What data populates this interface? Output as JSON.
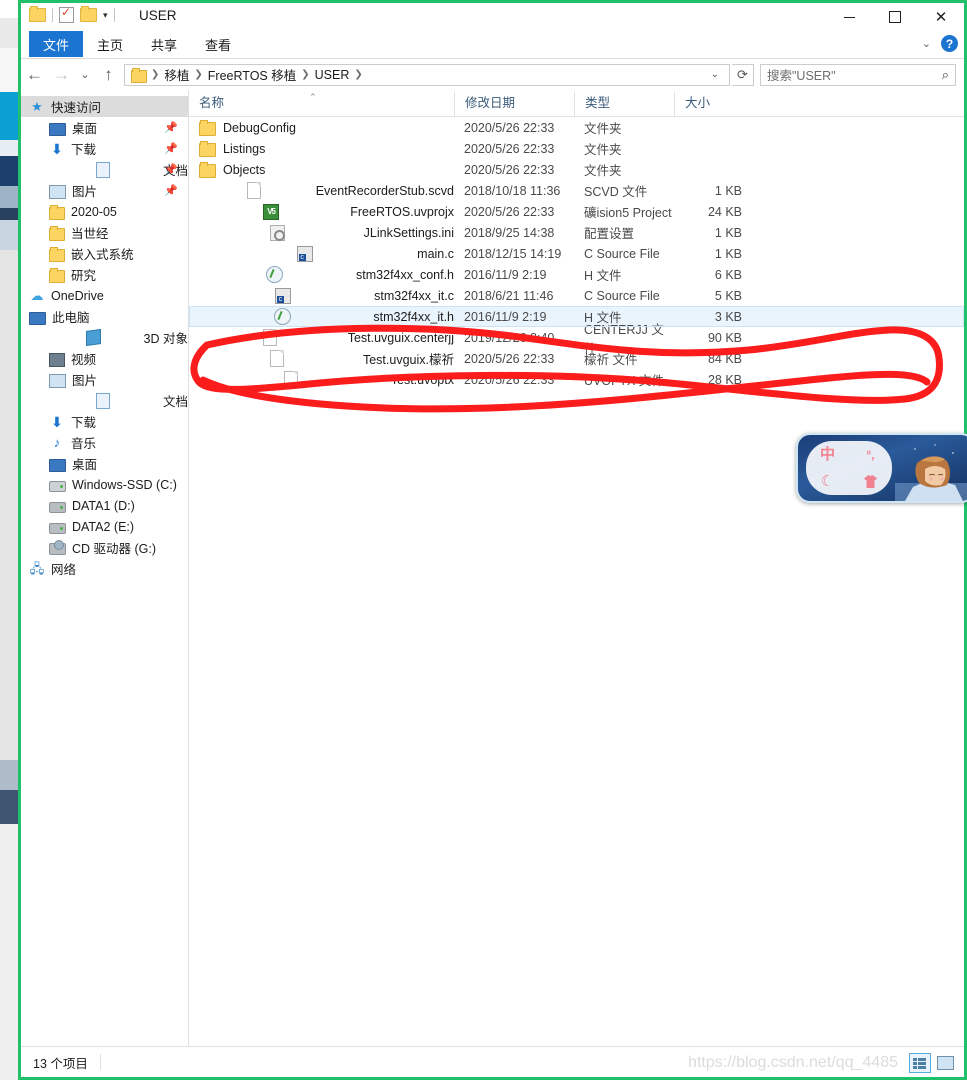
{
  "window": {
    "title": "USER",
    "quick_access": [
      "folder-icon",
      "properties-icon",
      "new-folder-icon",
      "customize-caret"
    ],
    "controls": {
      "minimize": "minimize-icon",
      "maximize": "maximize-icon",
      "close": "close-icon"
    },
    "help_label": "?"
  },
  "ribbon": {
    "tabs": [
      {
        "label": "文件",
        "active": true
      },
      {
        "label": "主页",
        "active": false
      },
      {
        "label": "共享",
        "active": false
      },
      {
        "label": "查看",
        "active": false
      }
    ]
  },
  "address": {
    "back": "back-arrow",
    "forward": "forward-arrow",
    "recent": "recent-caret",
    "up": "up-arrow",
    "breadcrumbs": [
      "移植",
      "FreeRTOS 移植",
      "USER"
    ],
    "dropdown_caret": "⌄",
    "refresh": "refresh-icon"
  },
  "search": {
    "placeholder": "搜索\"USER\"",
    "icon": "search-icon"
  },
  "navpane": {
    "items": [
      {
        "label": "快速访问",
        "icon": "star-icon",
        "indent": 0,
        "selected": true,
        "pinned": false
      },
      {
        "label": "桌面",
        "icon": "monitor-icon",
        "indent": 1,
        "selected": false,
        "pinned": true
      },
      {
        "label": "下载",
        "icon": "download-icon",
        "indent": 1,
        "selected": false,
        "pinned": true
      },
      {
        "label": "文档",
        "icon": "document-icon",
        "indent": 1,
        "selected": false,
        "pinned": true
      },
      {
        "label": "图片",
        "icon": "picture-icon",
        "indent": 1,
        "selected": false,
        "pinned": true
      },
      {
        "label": "2020-05",
        "icon": "folder-icon",
        "indent": 1,
        "selected": false,
        "pinned": false
      },
      {
        "label": "当世经",
        "icon": "folder-icon",
        "indent": 1,
        "selected": false,
        "pinned": false
      },
      {
        "label": "嵌入式系统",
        "icon": "folder-icon",
        "indent": 1,
        "selected": false,
        "pinned": false
      },
      {
        "label": "研究",
        "icon": "folder-icon",
        "indent": 1,
        "selected": false,
        "pinned": false
      },
      {
        "label": "OneDrive",
        "icon": "cloud-icon",
        "indent": 0,
        "selected": false,
        "pinned": false
      },
      {
        "label": "此电脑",
        "icon": "monitor-icon",
        "indent": 0,
        "selected": false,
        "pinned": false
      },
      {
        "label": "3D 对象",
        "icon": "cube-icon",
        "indent": 1,
        "selected": false,
        "pinned": false
      },
      {
        "label": "视频",
        "icon": "video-icon",
        "indent": 1,
        "selected": false,
        "pinned": false
      },
      {
        "label": "图片",
        "icon": "picture-icon",
        "indent": 1,
        "selected": false,
        "pinned": false
      },
      {
        "label": "文档",
        "icon": "document-icon",
        "indent": 1,
        "selected": false,
        "pinned": false
      },
      {
        "label": "下载",
        "icon": "download-icon",
        "indent": 1,
        "selected": false,
        "pinned": false
      },
      {
        "label": "音乐",
        "icon": "music-icon",
        "indent": 1,
        "selected": false,
        "pinned": false
      },
      {
        "label": "桌面",
        "icon": "monitor-icon",
        "indent": 1,
        "selected": false,
        "pinned": false
      },
      {
        "label": "Windows-SSD (C:)",
        "icon": "drive-system-icon",
        "indent": 1,
        "selected": false,
        "pinned": false
      },
      {
        "label": "DATA1 (D:)",
        "icon": "drive-icon",
        "indent": 1,
        "selected": false,
        "pinned": false
      },
      {
        "label": "DATA2 (E:)",
        "icon": "drive-icon",
        "indent": 1,
        "selected": false,
        "pinned": false
      },
      {
        "label": "CD 驱动器 (G:)",
        "icon": "cd-drive-icon",
        "indent": 1,
        "selected": false,
        "pinned": false
      },
      {
        "label": "网络",
        "icon": "network-icon",
        "indent": 0,
        "selected": false,
        "pinned": false
      }
    ]
  },
  "filelist": {
    "columns": [
      {
        "label": "名称",
        "key": "name"
      },
      {
        "label": "修改日期",
        "key": "date"
      },
      {
        "label": "类型",
        "key": "type"
      },
      {
        "label": "大小",
        "key": "size"
      }
    ],
    "sort_column": "名称",
    "sort_direction": "ascending",
    "rows": [
      {
        "name": "DebugConfig",
        "date": "2020/5/26 22:33",
        "type": "文件夹",
        "size": "",
        "icon": "folder-icon",
        "hover": false
      },
      {
        "name": "Listings",
        "date": "2020/5/26 22:33",
        "type": "文件夹",
        "size": "",
        "icon": "folder-icon",
        "hover": false
      },
      {
        "name": "Objects",
        "date": "2020/5/26 22:33",
        "type": "文件夹",
        "size": "",
        "icon": "folder-icon",
        "hover": false
      },
      {
        "name": "EventRecorderStub.scvd",
        "date": "2018/10/18 11:36",
        "type": "SCVD 文件",
        "size": "1 KB",
        "icon": "blank-file-icon",
        "hover": false
      },
      {
        "name": "FreeRTOS.uvprojx",
        "date": "2020/5/26 22:33",
        "type": "礦ision5 Project",
        "size": "24 KB",
        "icon": "uvision-icon",
        "hover": false
      },
      {
        "name": "JLinkSettings.ini",
        "date": "2018/9/25 14:38",
        "type": "配置设置",
        "size": "1 KB",
        "icon": "ini-file-icon",
        "hover": false
      },
      {
        "name": "main.c",
        "date": "2018/12/15 14:19",
        "type": "C Source File",
        "size": "1 KB",
        "icon": "c-source-icon",
        "hover": false
      },
      {
        "name": "stm32f4xx_conf.h",
        "date": "2016/11/9 2:19",
        "type": "H 文件",
        "size": "6 KB",
        "icon": "h-file-icon",
        "hover": false
      },
      {
        "name": "stm32f4xx_it.c",
        "date": "2018/6/21 11:46",
        "type": "C Source File",
        "size": "5 KB",
        "icon": "c-source-icon",
        "hover": false
      },
      {
        "name": "stm32f4xx_it.h",
        "date": "2016/11/9 2:19",
        "type": "H 文件",
        "size": "3 KB",
        "icon": "h-file-icon",
        "hover": true
      },
      {
        "name": "Test.uvguix.centerjj",
        "date": "2019/12/26 8:40",
        "type": "CENTERJJ 文件",
        "size": "90 KB",
        "icon": "blank-file-icon",
        "hover": false
      },
      {
        "name": "Test.uvguix.檬祈",
        "date": "2020/5/26 22:33",
        "type": "檬祈 文件",
        "size": "84 KB",
        "icon": "blank-file-icon",
        "hover": false
      },
      {
        "name": "Test.uvoptx",
        "date": "2020/5/26 22:33",
        "type": "UVOPTX 文件",
        "size": "28 KB",
        "icon": "blank-file-icon",
        "hover": false
      }
    ]
  },
  "annotation": {
    "color": "#fb1c1c",
    "shape": "hand-drawn-oval",
    "encircles": [
      "Test.uvguix.centerjj",
      "Test.uvguix.檬祈",
      "Test.uvoptx"
    ]
  },
  "ime_widget": {
    "keys": [
      "中",
      "°,",
      "☾",
      "shirt-icon"
    ],
    "mode_label": "中"
  },
  "statusbar": {
    "item_count": "13 个项目",
    "watermark": "https://blog.csdn.net/qq_4485",
    "views": [
      {
        "name": "details-view",
        "active": true
      },
      {
        "name": "large-icons-view",
        "active": false
      }
    ]
  },
  "colors": {
    "window_border": "#21c06a",
    "accent_blue": "#1b74d0",
    "annotation_red": "#fb1c1c",
    "selection_blue": "#eaf4fd"
  }
}
